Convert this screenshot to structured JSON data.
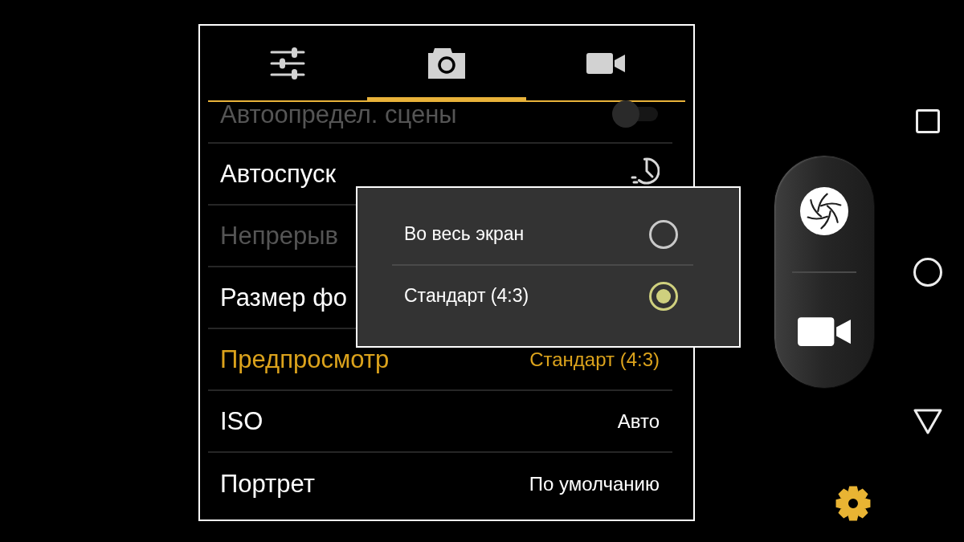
{
  "tabs": [
    {
      "kind": "general",
      "selected": false
    },
    {
      "kind": "photo",
      "selected": true
    },
    {
      "kind": "video",
      "selected": false
    }
  ],
  "settings": [
    {
      "kind": "toggle",
      "label": "Автоопредел. сцены",
      "disabled": true,
      "selected": false,
      "on": false
    },
    {
      "kind": "timer",
      "label": "Автоспуск",
      "disabled": false,
      "selected": false
    },
    {
      "kind": "plain",
      "label": "Непрерыв",
      "disabled": true,
      "selected": false
    },
    {
      "kind": "plain",
      "label": "Размер фо",
      "disabled": false,
      "selected": false
    },
    {
      "kind": "value",
      "label": "Предпросмотр",
      "value": "Стандарт (4:3)",
      "disabled": false,
      "selected": true
    },
    {
      "kind": "value",
      "label": "ISO",
      "value": "Авто",
      "disabled": false,
      "selected": false
    },
    {
      "kind": "value",
      "label": "Портрет",
      "value": "По умолчанию",
      "disabled": false,
      "selected": false
    }
  ],
  "dialog": {
    "options": [
      {
        "label": "Во весь экран",
        "selected": false
      },
      {
        "label": "Стандарт (4:3)",
        "selected": true
      }
    ]
  }
}
